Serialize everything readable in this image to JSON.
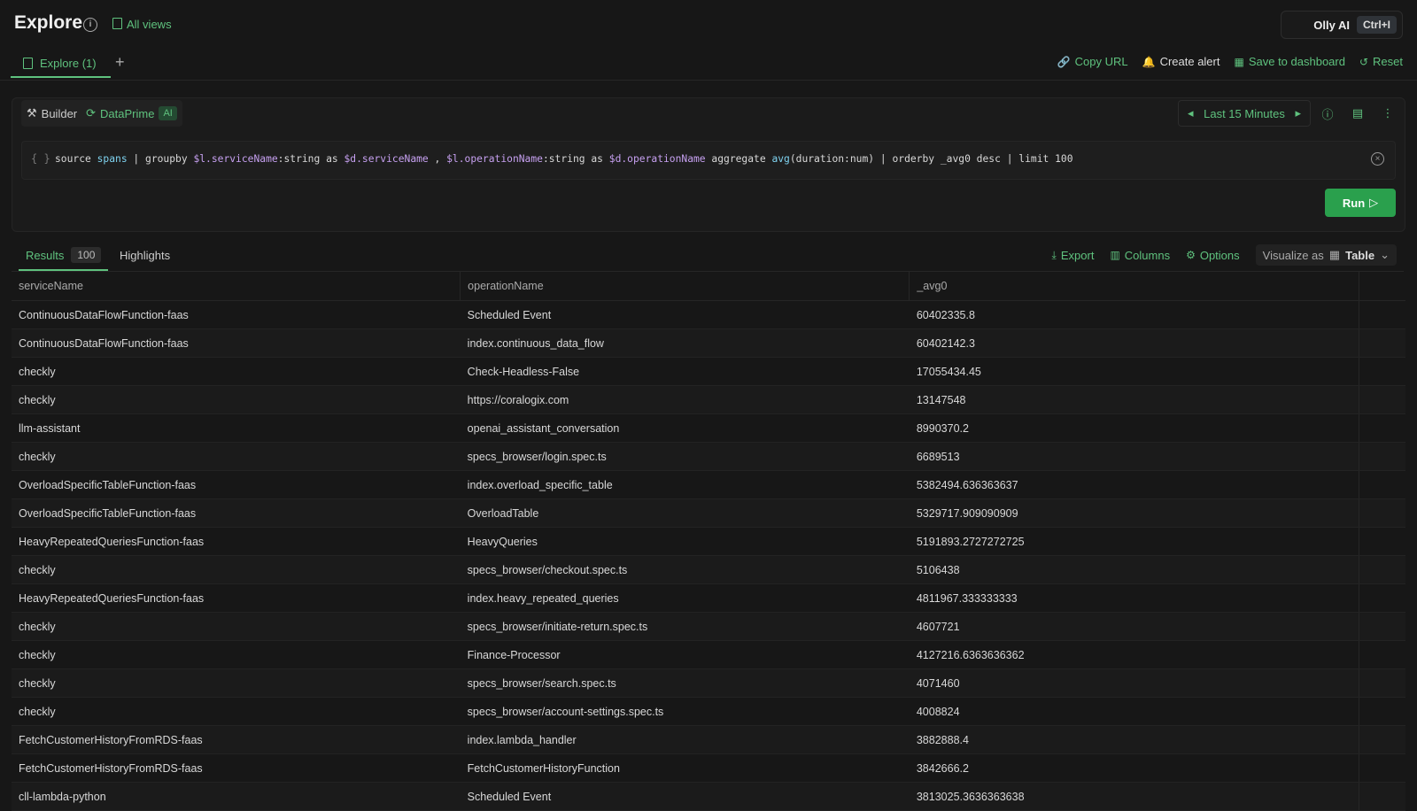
{
  "header": {
    "title": "Explore",
    "all_views": "All views",
    "olly_label": "Olly AI",
    "olly_shortcut": "Ctrl+I"
  },
  "tabs": [
    {
      "label": "Explore (1)"
    }
  ],
  "actions": {
    "copy_url": "Copy URL",
    "create_alert": "Create alert",
    "save_dashboard": "Save to dashboard",
    "reset": "Reset"
  },
  "query": {
    "mode_builder": "Builder",
    "mode_dataprime": "DataPrime",
    "ai_badge": "AI",
    "time_range": "Last 15 Minutes",
    "run": "Run"
  },
  "results": {
    "tab_results": "Results",
    "count": "100",
    "tab_highlights": "Highlights",
    "export": "Export",
    "columns": "Columns",
    "options": "Options",
    "visualize_as": "Visualize as",
    "visualize_type": "Table"
  },
  "table": {
    "headers": [
      "serviceName",
      "operationName",
      "_avg0"
    ],
    "rows": [
      [
        "ContinuousDataFlowFunction-faas",
        "Scheduled Event",
        "60402335.8"
      ],
      [
        "ContinuousDataFlowFunction-faas",
        "index.continuous_data_flow",
        "60402142.3"
      ],
      [
        "checkly",
        "Check-Headless-False",
        "17055434.45"
      ],
      [
        "checkly",
        "https://coralogix.com",
        "13147548"
      ],
      [
        "llm-assistant",
        "openai_assistant_conversation",
        "8990370.2"
      ],
      [
        "checkly",
        "specs_browser/login.spec.ts",
        "6689513"
      ],
      [
        "OverloadSpecificTableFunction-faas",
        "index.overload_specific_table",
        "5382494.636363637"
      ],
      [
        "OverloadSpecificTableFunction-faas",
        "OverloadTable",
        "5329717.909090909"
      ],
      [
        "HeavyRepeatedQueriesFunction-faas",
        "HeavyQueries",
        "5191893.2727272725"
      ],
      [
        "checkly",
        "specs_browser/checkout.spec.ts",
        "5106438"
      ],
      [
        "HeavyRepeatedQueriesFunction-faas",
        "index.heavy_repeated_queries",
        "4811967.333333333"
      ],
      [
        "checkly",
        "specs_browser/initiate-return.spec.ts",
        "4607721"
      ],
      [
        "checkly",
        "Finance-Processor",
        "4127216.6363636362"
      ],
      [
        "checkly",
        "specs_browser/search.spec.ts",
        "4071460"
      ],
      [
        "checkly",
        "specs_browser/account-settings.spec.ts",
        "4008824"
      ],
      [
        "FetchCustomerHistoryFromRDS-faas",
        "index.lambda_handler",
        "3882888.4"
      ],
      [
        "FetchCustomerHistoryFromRDS-faas",
        "FetchCustomerHistoryFunction",
        "3842666.2"
      ],
      [
        "cll-lambda-python",
        "Scheduled Event",
        "3813025.3636363638"
      ]
    ]
  }
}
